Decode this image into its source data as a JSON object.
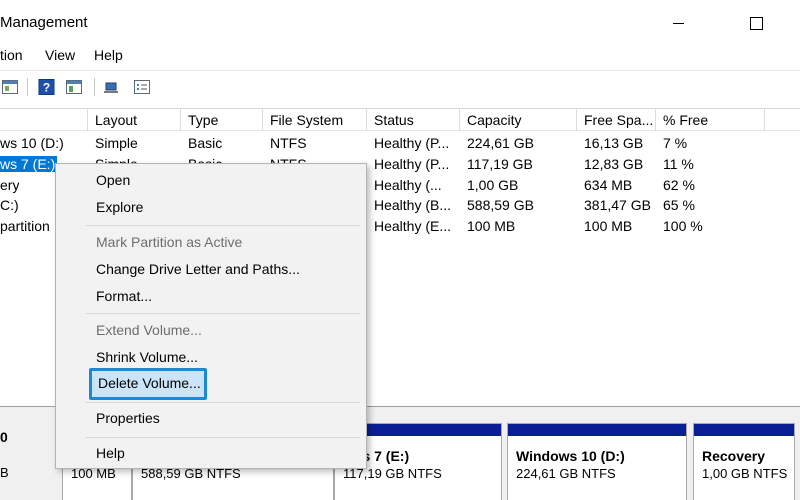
{
  "window": {
    "title": "Management",
    "minimize_label": "minimize",
    "maximize_label": "maximize"
  },
  "menu": [
    "tion",
    "View",
    "Help"
  ],
  "toolbar": {
    "icons": [
      "properties-icon",
      "help-icon",
      "console-icon",
      "connect-icon",
      "list-icon"
    ]
  },
  "table": {
    "columns": [
      "Layout",
      "Type",
      "File System",
      "Status",
      "Capacity",
      "Free Spa...",
      "% Free"
    ],
    "rows": [
      {
        "volume": "ws 10 (D:)",
        "layout": "Simple",
        "type": "Basic",
        "fs": "NTFS",
        "status": "Healthy (P...",
        "capacity": "224,61 GB",
        "free": "16,13 GB",
        "pct": "7 %"
      },
      {
        "volume": "ws 7 (E:)",
        "layout": "Simple",
        "type": "Basic",
        "fs": "NTFS",
        "status": "Healthy (P...",
        "capacity": "117,19 GB",
        "free": "12,83 GB",
        "pct": "11 %"
      },
      {
        "volume": "ery",
        "layout": "",
        "type": "",
        "fs": "",
        "status": "Healthy (...",
        "capacity": "1,00 GB",
        "free": "634 MB",
        "pct": "62 %"
      },
      {
        "volume": "C:)",
        "layout": "",
        "type": "",
        "fs": "",
        "status": "Healthy (B...",
        "capacity": "588,59 GB",
        "free": "381,47 GB",
        "pct": "65 %"
      },
      {
        "volume": "partition",
        "layout": "",
        "type": "",
        "fs": "",
        "status": "Healthy (E...",
        "capacity": "100 MB",
        "free": "100 MB",
        "pct": "100 %"
      }
    ]
  },
  "lower_pane": {
    "disk_label": "0",
    "disk_sub": "B",
    "partitions": [
      {
        "name": "",
        "detail": "100 MB"
      },
      {
        "name": "",
        "detail": "588,59 GB NTFS"
      },
      {
        "name": "ows 7  (E:)",
        "detail": "117,19 GB NTFS"
      },
      {
        "name": "Windows 10  (D:)",
        "detail": "224,61 GB NTFS"
      },
      {
        "name": "Recovery",
        "detail": "1,00 GB NTFS"
      }
    ]
  },
  "context_menu": {
    "open": "Open",
    "explore": "Explore",
    "mark_active": "Mark Partition as Active",
    "change_letter": "Change Drive Letter and Paths...",
    "format": "Format...",
    "extend": "Extend Volume...",
    "shrink": "Shrink Volume...",
    "delete": "Delete Volume...",
    "properties": "Properties",
    "help": "Help"
  },
  "colors": {
    "selection": "#0078d7",
    "partition_header": "#0a1f96",
    "highlight_border": "#1a8ad4",
    "highlight_fill": "#cce4f7"
  }
}
